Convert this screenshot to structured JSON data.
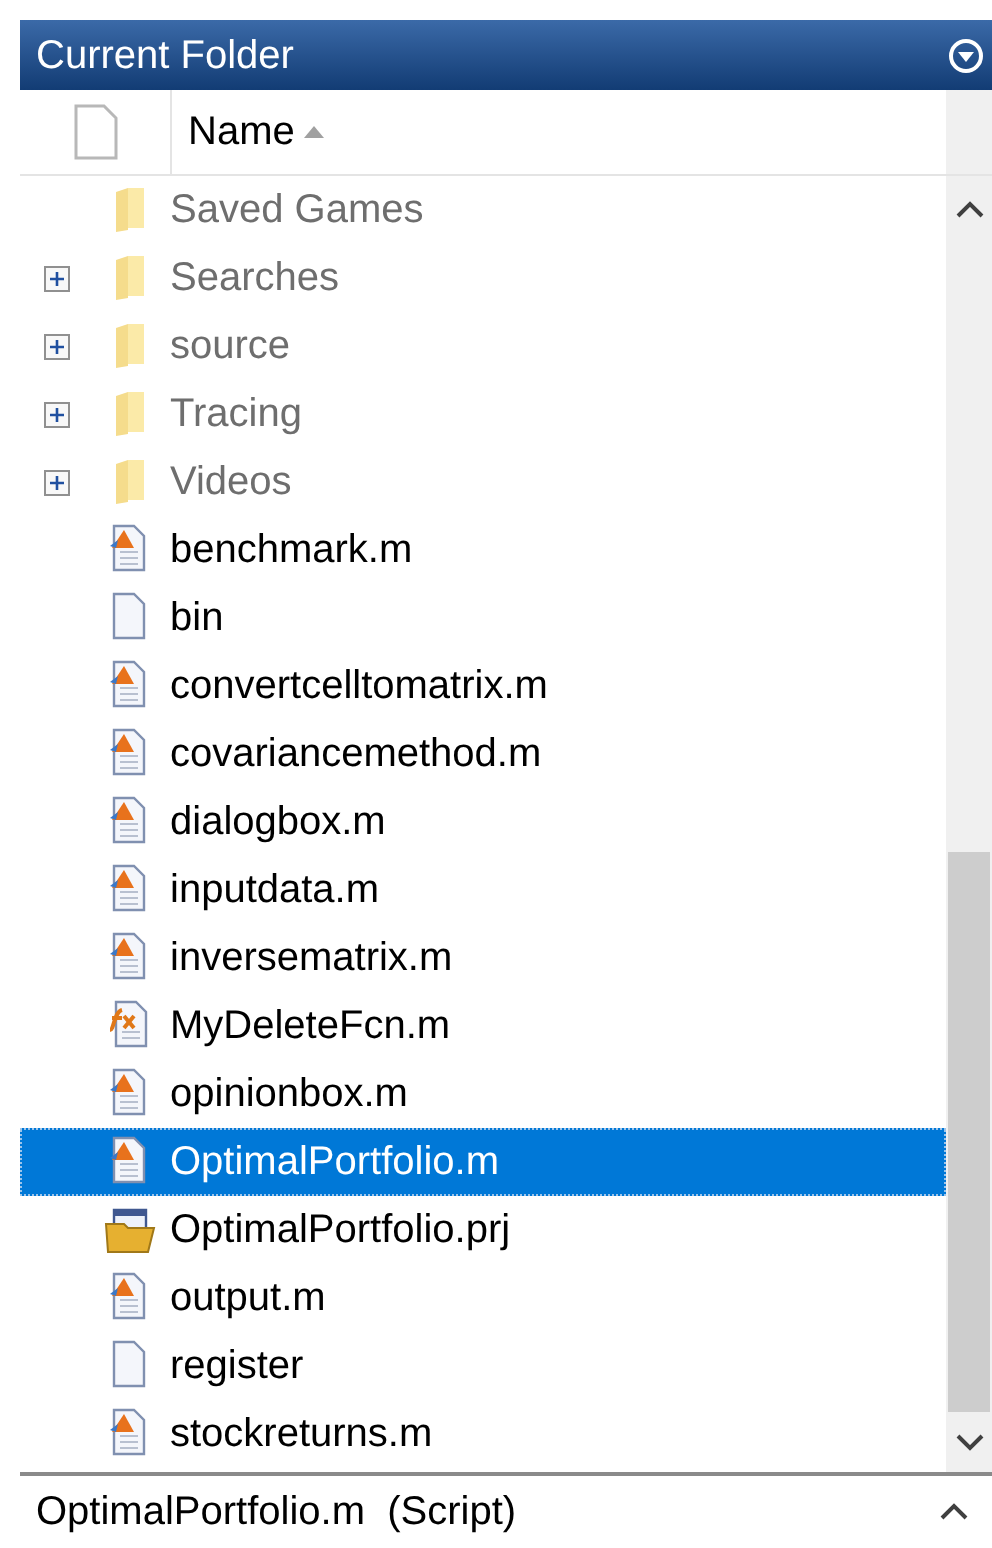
{
  "panel": {
    "title": "Current Folder"
  },
  "table": {
    "columns": [
      {
        "label": "Name",
        "sort_ascending": true
      }
    ],
    "rows": [
      {
        "name": "Saved Games",
        "kind": "folder",
        "expandable": false,
        "selected": false
      },
      {
        "name": "Searches",
        "kind": "folder",
        "expandable": true,
        "selected": false
      },
      {
        "name": "source",
        "kind": "folder",
        "expandable": true,
        "selected": false
      },
      {
        "name": "Tracing",
        "kind": "folder",
        "expandable": true,
        "selected": false
      },
      {
        "name": "Videos",
        "kind": "folder",
        "expandable": true,
        "selected": false
      },
      {
        "name": "benchmark.m",
        "kind": "script",
        "selected": false
      },
      {
        "name": "bin",
        "kind": "file",
        "selected": false
      },
      {
        "name": "convertcelltomatrix.m",
        "kind": "script",
        "selected": false
      },
      {
        "name": "covariancemethod.m",
        "kind": "script",
        "selected": false
      },
      {
        "name": "dialogbox.m",
        "kind": "script",
        "selected": false
      },
      {
        "name": "inputdata.m",
        "kind": "script",
        "selected": false
      },
      {
        "name": "inversematrix.m",
        "kind": "script",
        "selected": false
      },
      {
        "name": "MyDeleteFcn.m",
        "kind": "function",
        "selected": false
      },
      {
        "name": "opinionbox.m",
        "kind": "script",
        "selected": false
      },
      {
        "name": "OptimalPortfolio.m",
        "kind": "script",
        "selected": true
      },
      {
        "name": "OptimalPortfolio.prj",
        "kind": "project",
        "selected": false
      },
      {
        "name": "output.m",
        "kind": "script",
        "selected": false
      },
      {
        "name": "register",
        "kind": "file",
        "selected": false
      },
      {
        "name": "stockreturns.m",
        "kind": "script",
        "selected": false
      }
    ]
  },
  "details": {
    "text": "OptimalPortfolio.m  (Script)",
    "expanded": false
  }
}
